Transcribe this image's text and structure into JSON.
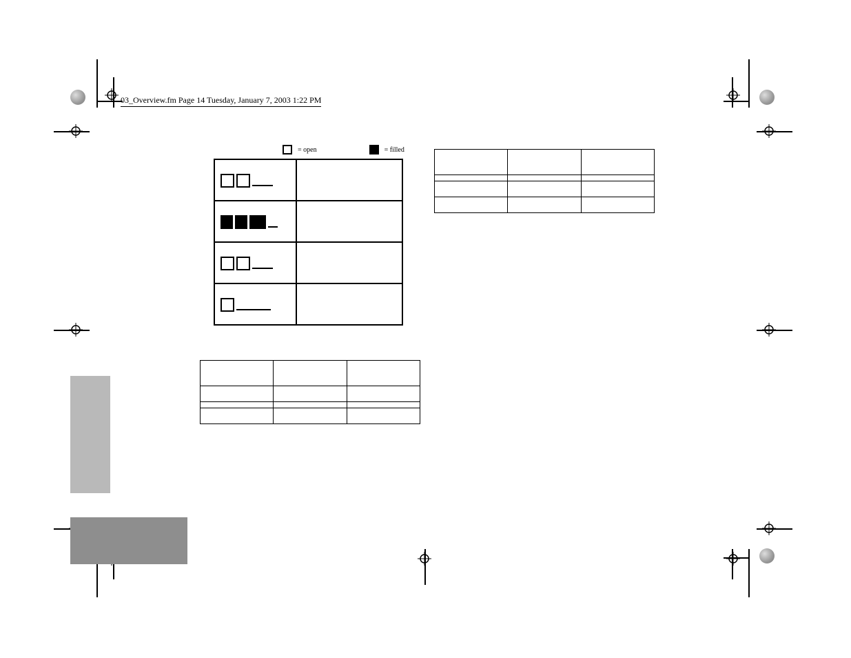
{
  "meta": {
    "header_line": "03_Overview.fm  Page 14  Tuesday, January 7, 2003  1:22 PM"
  },
  "legend": {
    "open_label": " = open",
    "filled_label": " = filled"
  },
  "pattern_rows": [
    {
      "desc": ""
    },
    {
      "desc": ""
    },
    {
      "desc": ""
    },
    {
      "desc": ""
    }
  ],
  "battery_table": {
    "label": "",
    "headers": [
      "",
      "",
      ""
    ],
    "rows": [
      [
        "",
        "",
        ""
      ],
      [
        "",
        "",
        ""
      ],
      [
        "",
        "",
        ""
      ]
    ]
  },
  "ink_table": {
    "label": "",
    "headers": [
      "",
      "",
      ""
    ],
    "rows": [
      [
        "",
        "",
        ""
      ],
      [
        "",
        "",
        ""
      ],
      [
        "",
        "",
        ""
      ]
    ]
  }
}
